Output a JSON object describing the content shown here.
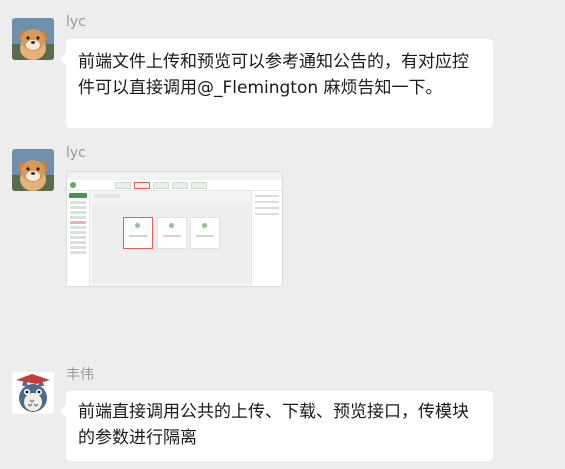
{
  "messages": [
    {
      "sender": "lyc",
      "avatar_icon": "shiba-dog-avatar-icon",
      "text_lines": [
        "前端文件上传和预览可以参考通知公告的，有对应控",
        "件可以直接调用@_Flemington 麻烦告知一下。"
      ]
    },
    {
      "sender": "lyc",
      "avatar_icon": "shiba-dog-avatar-icon",
      "image": "screenshot-thumbnail"
    },
    {
      "sender": "丰伟",
      "avatar_icon": "totoro-avatar-icon",
      "text_lines": [
        "前端直接调用公共的上传、下载、预览接口，传模块",
        "的参数进行隔离"
      ]
    }
  ],
  "colors": {
    "background": "#ededed",
    "bubble": "#ffffff",
    "sender_name": "#9a9a9a",
    "highlight": "#e06060",
    "brand_green": "#3e9a4a"
  }
}
